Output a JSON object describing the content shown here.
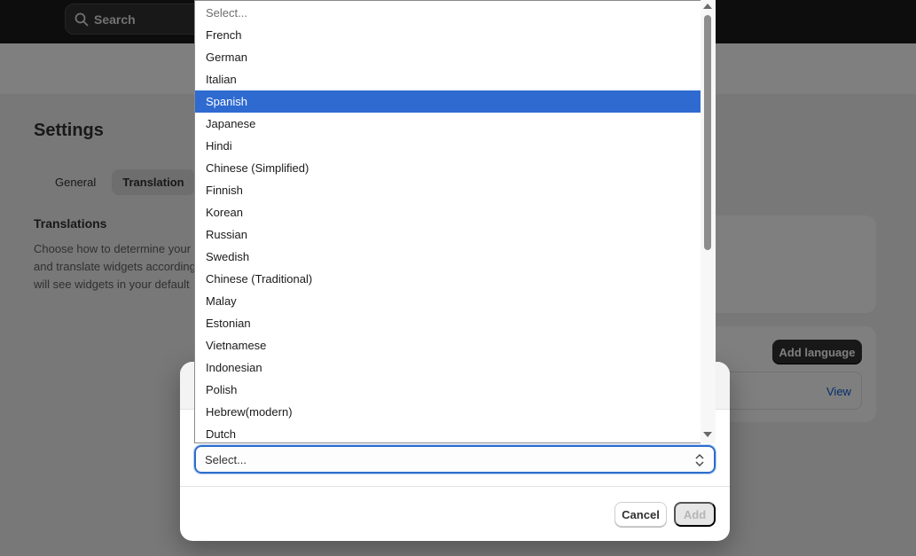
{
  "topbar": {
    "search_label": "Search"
  },
  "page": {
    "title": "Settings",
    "tabs": [
      {
        "label": "General",
        "active": false
      },
      {
        "label": "Translation",
        "active": true
      }
    ],
    "section_title": "Translations",
    "section_desc": "Choose how to determine your and translate widgets according will see widgets in your default",
    "add_language_label": "Add language",
    "view_label": "View"
  },
  "modal": {
    "select_value": "Select...",
    "cancel_label": "Cancel",
    "add_label": "Add"
  },
  "dropdown": {
    "selected_index": 4,
    "options": [
      "Select...",
      "French",
      "German",
      "Italian",
      "Spanish",
      "Japanese",
      "Hindi",
      "Chinese (Simplified)",
      "Finnish",
      "Korean",
      "Russian",
      "Swedish",
      "Chinese (Traditional)",
      "Malay",
      "Estonian",
      "Vietnamese",
      "Indonesian",
      "Polish",
      "Hebrew(modern)",
      "Dutch"
    ]
  },
  "colors": {
    "topbar": "#1a1a1a",
    "selected_option": "#2f6ad1",
    "focus_ring": "#2c6ecb",
    "primary_button": "#303030"
  }
}
